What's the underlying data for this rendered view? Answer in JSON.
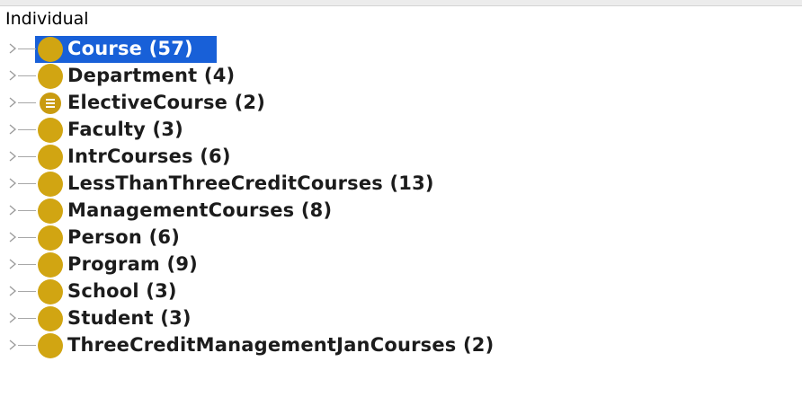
{
  "root": {
    "label": "Individual"
  },
  "colors": {
    "bullet": "#d1a512",
    "selection": "#1860d8"
  },
  "items": [
    {
      "label": "Course (57)",
      "icon": "class-circle-icon",
      "selected": true
    },
    {
      "label": "Department (4)",
      "icon": "class-circle-icon"
    },
    {
      "label": "ElectiveCourse (2)",
      "icon": "defined-class-icon"
    },
    {
      "label": "Faculty (3)",
      "icon": "class-circle-icon"
    },
    {
      "label": "IntrCourses (6)",
      "icon": "class-circle-icon"
    },
    {
      "label": "LessThanThreeCreditCourses (13)",
      "icon": "class-circle-icon"
    },
    {
      "label": "ManagementCourses (8)",
      "icon": "class-circle-icon"
    },
    {
      "label": "Person (6)",
      "icon": "class-circle-icon"
    },
    {
      "label": "Program (9)",
      "icon": "class-circle-icon"
    },
    {
      "label": "School (3)",
      "icon": "class-circle-icon"
    },
    {
      "label": "Student (3)",
      "icon": "class-circle-icon"
    },
    {
      "label": "ThreeCreditManagementJanCourses (2)",
      "icon": "class-circle-icon"
    }
  ]
}
